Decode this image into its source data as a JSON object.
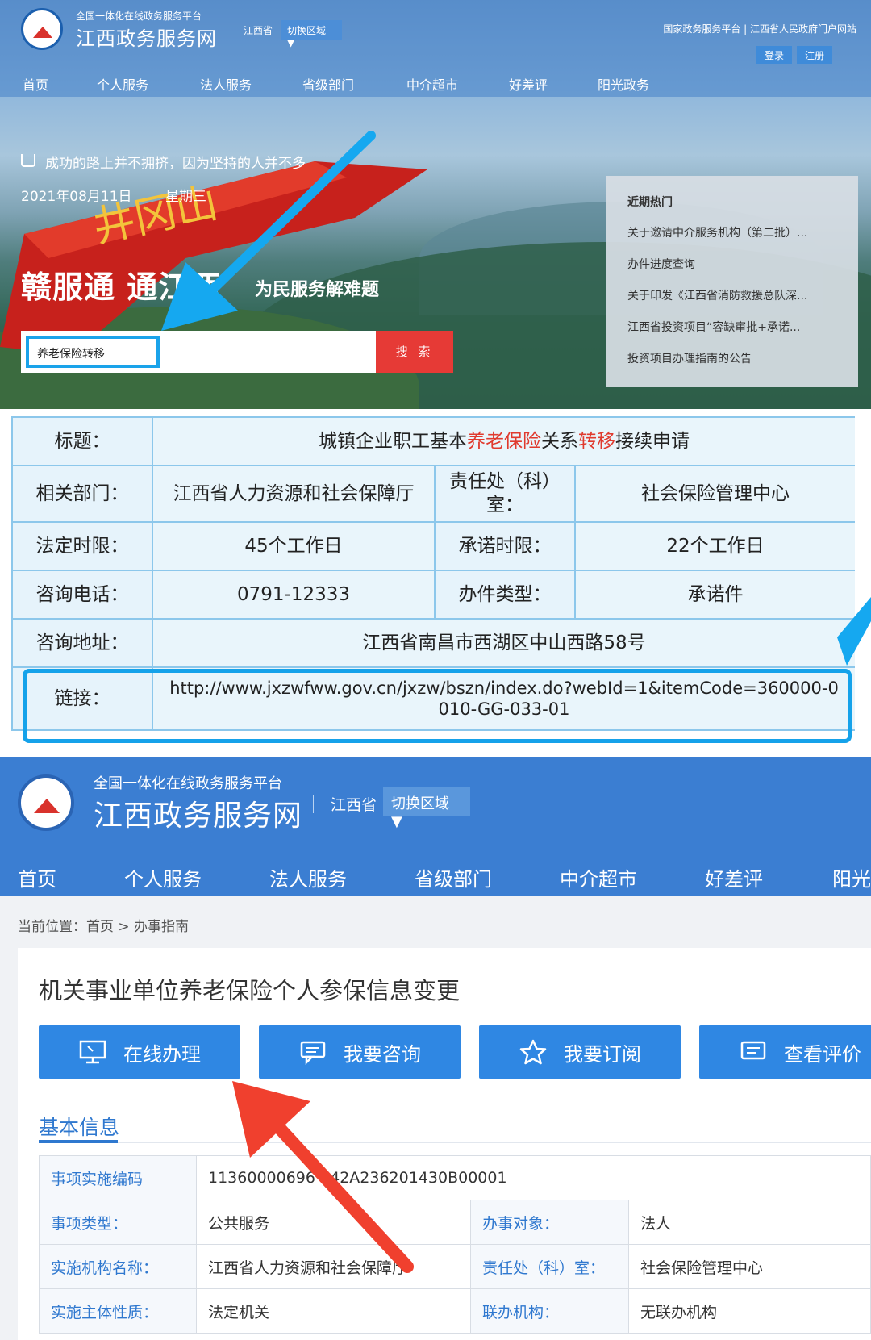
{
  "hero": {
    "platform_subtitle": "全国一体化在线政务服务平台",
    "site_name": "江西政务服务网",
    "province": "江西省",
    "switch_region": "切换区域 ▼",
    "top_links": "国家政务服务平台 | 江西省人民政府门户网站",
    "login": "登录",
    "register": "注册",
    "nav": [
      "首页",
      "个人服务",
      "法人服务",
      "省级部门",
      "中介超市",
      "好差评",
      "阳光政务"
    ],
    "slogan": "成功的路上并不拥挤，因为坚持的人并不多",
    "date": "2021年08月11日",
    "weekday": "星期三",
    "headline": "赣服通  通江西",
    "headline_sub": "为民服务解难题",
    "search_value": "养老保险转移",
    "search_button": "搜 索",
    "hot_title": "近期热门",
    "hot_items": [
      "关于邀请中介服务机构（第二批）...",
      "办件进度查询",
      "关于印发《江西省消防救援总队深...",
      "江西省投资项目“容缺审批+承诺...",
      "投资项目办理指南的公告"
    ],
    "flag_text": "井冈山"
  },
  "info_table": {
    "title_label": "标题：",
    "title_parts": [
      "城镇企业职工基本",
      "养老保险",
      "关系",
      "转移",
      "接续申请"
    ],
    "dept_label": "相关部门：",
    "dept_value": "江西省人力资源和社会保障厅",
    "office_label": "责任处（科）室：",
    "office_value": "社会保险管理中心",
    "legal_limit_label": "法定时限：",
    "legal_limit_value": "45个工作日",
    "promise_limit_label": "承诺时限：",
    "promise_limit_value": "22个工作日",
    "phone_label": "咨询电话：",
    "phone_value": "0791-12333",
    "type_label": "办件类型：",
    "type_value": "承诺件",
    "address_label": "咨询地址：",
    "address_value": "江西省南昌市西湖区中山西路58号",
    "link_label": "链接：",
    "link_value": "http://www.jxzwfww.gov.cn/jxzw/bszn/index.do?webId=1&itemCode=360000-0010-GG-033-01"
  },
  "guide": {
    "platform_subtitle": "全国一体化在线政务服务平台",
    "site_name": "江西政务服务网",
    "province": "江西省",
    "switch_region": "切换区域 ▼",
    "nav": [
      "首页",
      "个人服务",
      "法人服务",
      "省级部门",
      "中介超市",
      "好差评",
      "阳光"
    ],
    "breadcrumb": "当前位置：首页 > 办事指南",
    "title": "机关事业单位养老保险个人参保信息变更",
    "buttons": [
      {
        "label": "在线办理",
        "icon": "monitor-icon"
      },
      {
        "label": "我要咨询",
        "icon": "chat-icon"
      },
      {
        "label": "我要订阅",
        "icon": "star-icon"
      },
      {
        "label": "查看评价",
        "icon": "comment-icon"
      }
    ],
    "basic_info_tab": "基本信息",
    "rows": [
      {
        "label": "事项实施编码",
        "value": "11360000696  942A236201430B00001"
      },
      {
        "label": "事项类型：",
        "value": "公共服务",
        "label2": "办事对象：",
        "value2": "法人"
      },
      {
        "label": "实施机构名称：",
        "value": "江西省人力资源和社会保障厅",
        "label2": "责任处（科）室：",
        "value2": "社会保险管理中心"
      },
      {
        "label": "实施主体性质：",
        "value": "法定机关",
        "label2": "联办机构：",
        "value2": "无联办机构"
      }
    ]
  },
  "colors": {
    "primary_blue": "#3b7ed2",
    "accent_red": "#e63a36",
    "highlight_cyan": "#15a2ea",
    "annotation_red": "#f0402e"
  }
}
